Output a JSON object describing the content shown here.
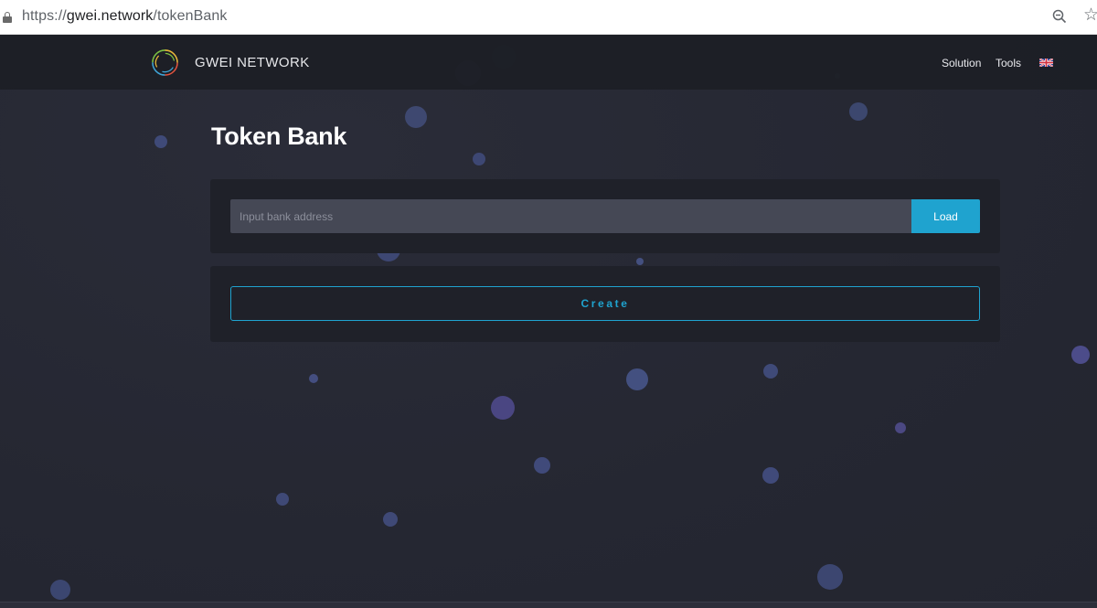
{
  "browser": {
    "url_scheme": "https://",
    "url_host": "gwei.network",
    "url_path": "/tokenBank",
    "icons": [
      "lock-icon",
      "zoom-icon",
      "star-icon"
    ]
  },
  "header": {
    "brand": "GWEI NETWORK",
    "nav": {
      "solution": "Solution",
      "tools": "Tools"
    },
    "language_icon": "uk-flag-icon"
  },
  "main": {
    "title": "Token Bank",
    "bank_input": {
      "value": "",
      "placeholder": "Input bank address"
    },
    "load_label": "Load",
    "create_label": "Create"
  },
  "colors": {
    "background": "#262833",
    "navbar": "#1c1e25",
    "card": "#1f2129",
    "accent": "#1fa3cf",
    "input": "#454855"
  }
}
